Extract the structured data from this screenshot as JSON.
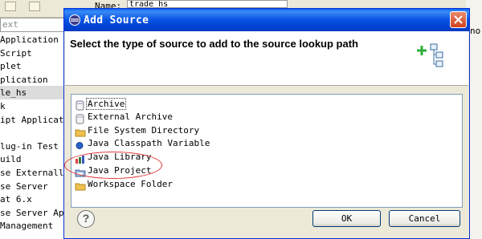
{
  "background": {
    "filter_placeholder": "ext",
    "name_label": "Name:",
    "name_value": "trade_hs",
    "right_fragment": "nor",
    "launch_items": [
      {
        "label": " Application",
        "selected": false
      },
      {
        "label": "Script",
        "selected": false
      },
      {
        "label": "plet",
        "selected": false
      },
      {
        "label": "plication",
        "selected": false
      },
      {
        "label": "le_hs",
        "selected": true
      },
      {
        "label": "k",
        "selected": false
      },
      {
        "label": "ipt Applicatio",
        "selected": false
      },
      {
        "label": "",
        "selected": false
      },
      {
        "label": "lug-in Test",
        "selected": false
      },
      {
        "label": "uild",
        "selected": false
      },
      {
        "label": "se Externally",
        "selected": false
      },
      {
        "label": "se Server",
        "selected": false
      },
      {
        "label": "at 6.x",
        "selected": false
      },
      {
        "label": "se Server App",
        "selected": false
      },
      {
        "label": "Management",
        "selected": false
      }
    ]
  },
  "dialog": {
    "title": "Add Source",
    "message": "Select the type of source to add to the source lookup path",
    "source_types": [
      {
        "label": "Archive",
        "icon": "jar-icon",
        "selected": true
      },
      {
        "label": "External Archive",
        "icon": "jar-icon",
        "selected": false
      },
      {
        "label": "File System Directory",
        "icon": "folder-icon",
        "selected": false
      },
      {
        "label": "Java Classpath Variable",
        "icon": "blue-dot-icon",
        "selected": false
      },
      {
        "label": "Java Library",
        "icon": "library-icon",
        "selected": false
      },
      {
        "label": "Java Project",
        "icon": "java-project-icon",
        "selected": false
      },
      {
        "label": "Workspace Folder",
        "icon": "folder-icon",
        "selected": false
      }
    ],
    "help_label": "?",
    "ok_label": "OK",
    "cancel_label": "Cancel"
  },
  "colors": {
    "titlebar": "#0752e3",
    "highlight_ellipse": "#e23838",
    "folder": "#f0c050"
  }
}
